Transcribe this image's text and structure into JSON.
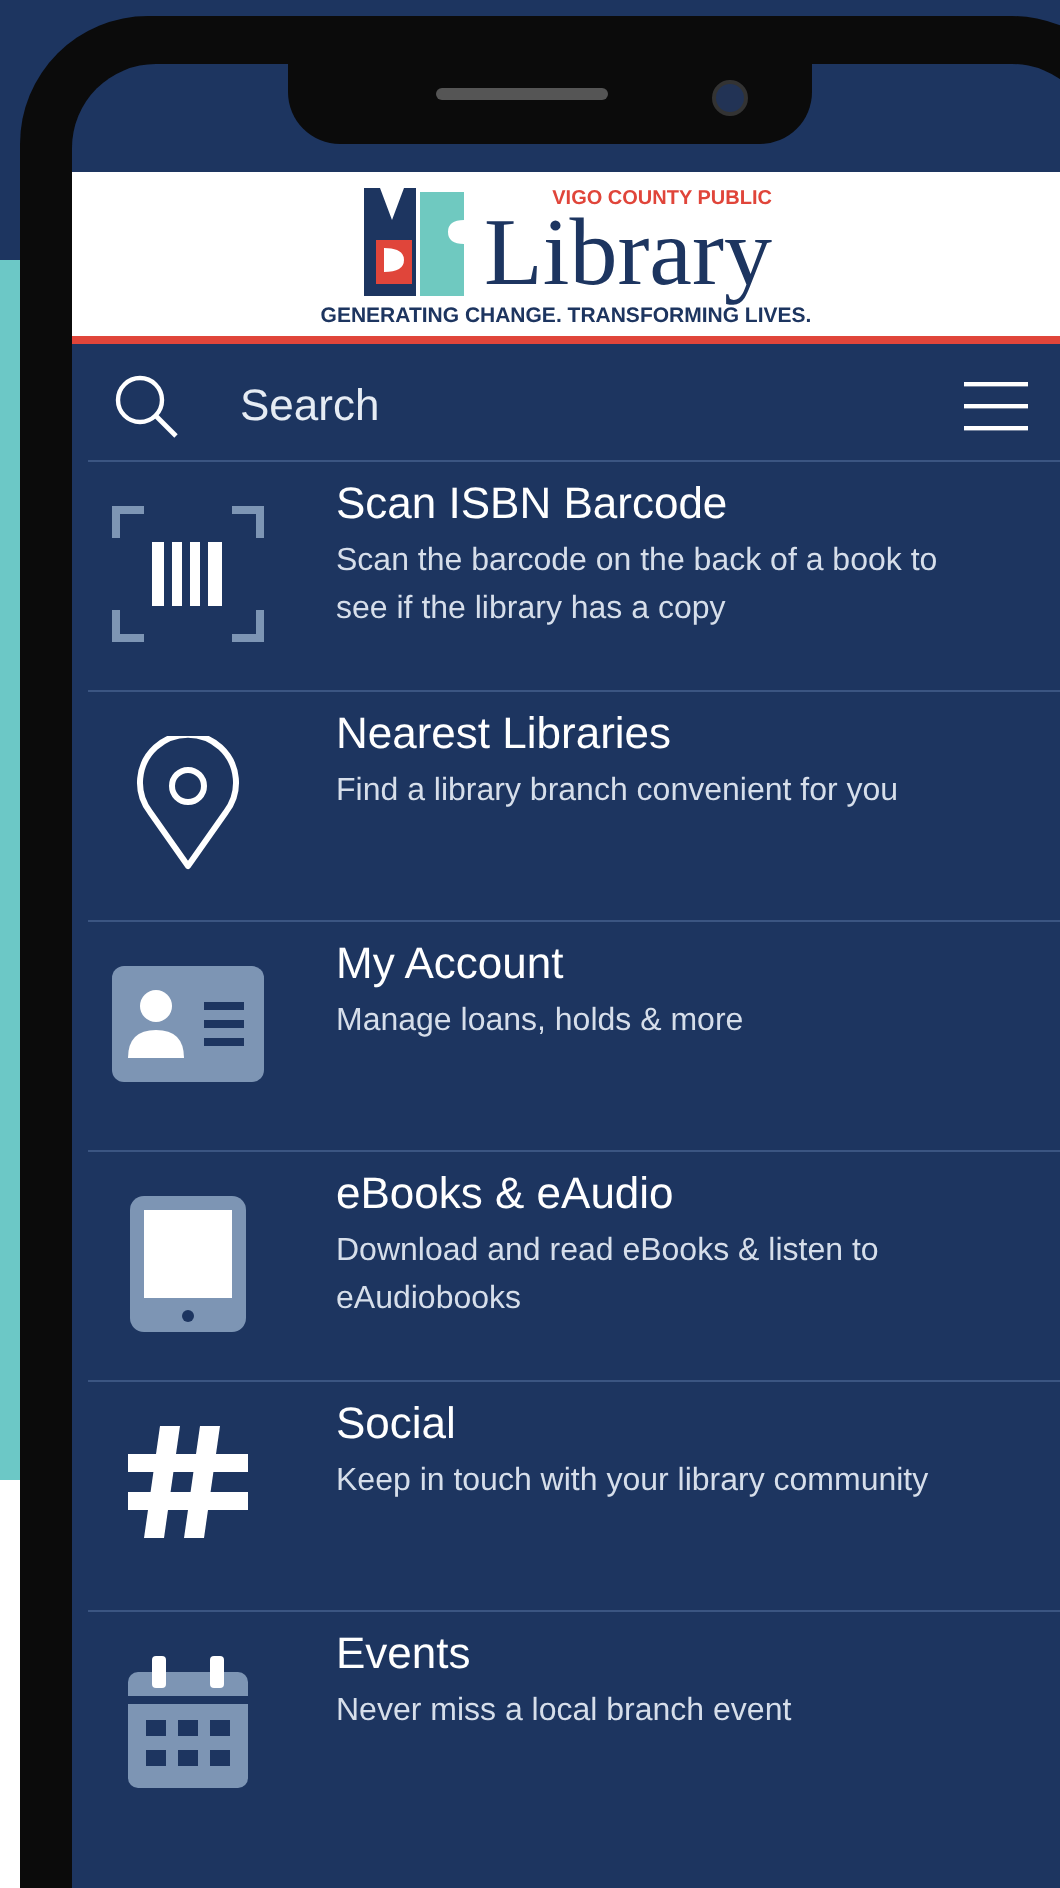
{
  "header": {
    "org": "VIGO COUNTY PUBLIC",
    "name": "Library",
    "tagline": "GENERATING CHANGE. TRANSFORMING LIVES."
  },
  "search": {
    "placeholder": "Search"
  },
  "menu_items": [
    {
      "kind": "barcode",
      "title": "Scan ISBN Barcode",
      "description": "Scan the barcode on the back of a book to see if the library has a copy"
    },
    {
      "kind": "pin",
      "title": "Nearest Libraries",
      "description": "Find a library branch convenient for you"
    },
    {
      "kind": "account",
      "title": "My Account",
      "description": "Manage loans, holds & more"
    },
    {
      "kind": "tablet",
      "title": "eBooks & eAudio",
      "description": "Download and read eBooks & listen to eAudiobooks"
    },
    {
      "kind": "hash",
      "title": "Social",
      "description": "Keep in touch with your library community"
    },
    {
      "kind": "calendar",
      "title": "Events",
      "description": "Never miss a local branch event"
    }
  ]
}
